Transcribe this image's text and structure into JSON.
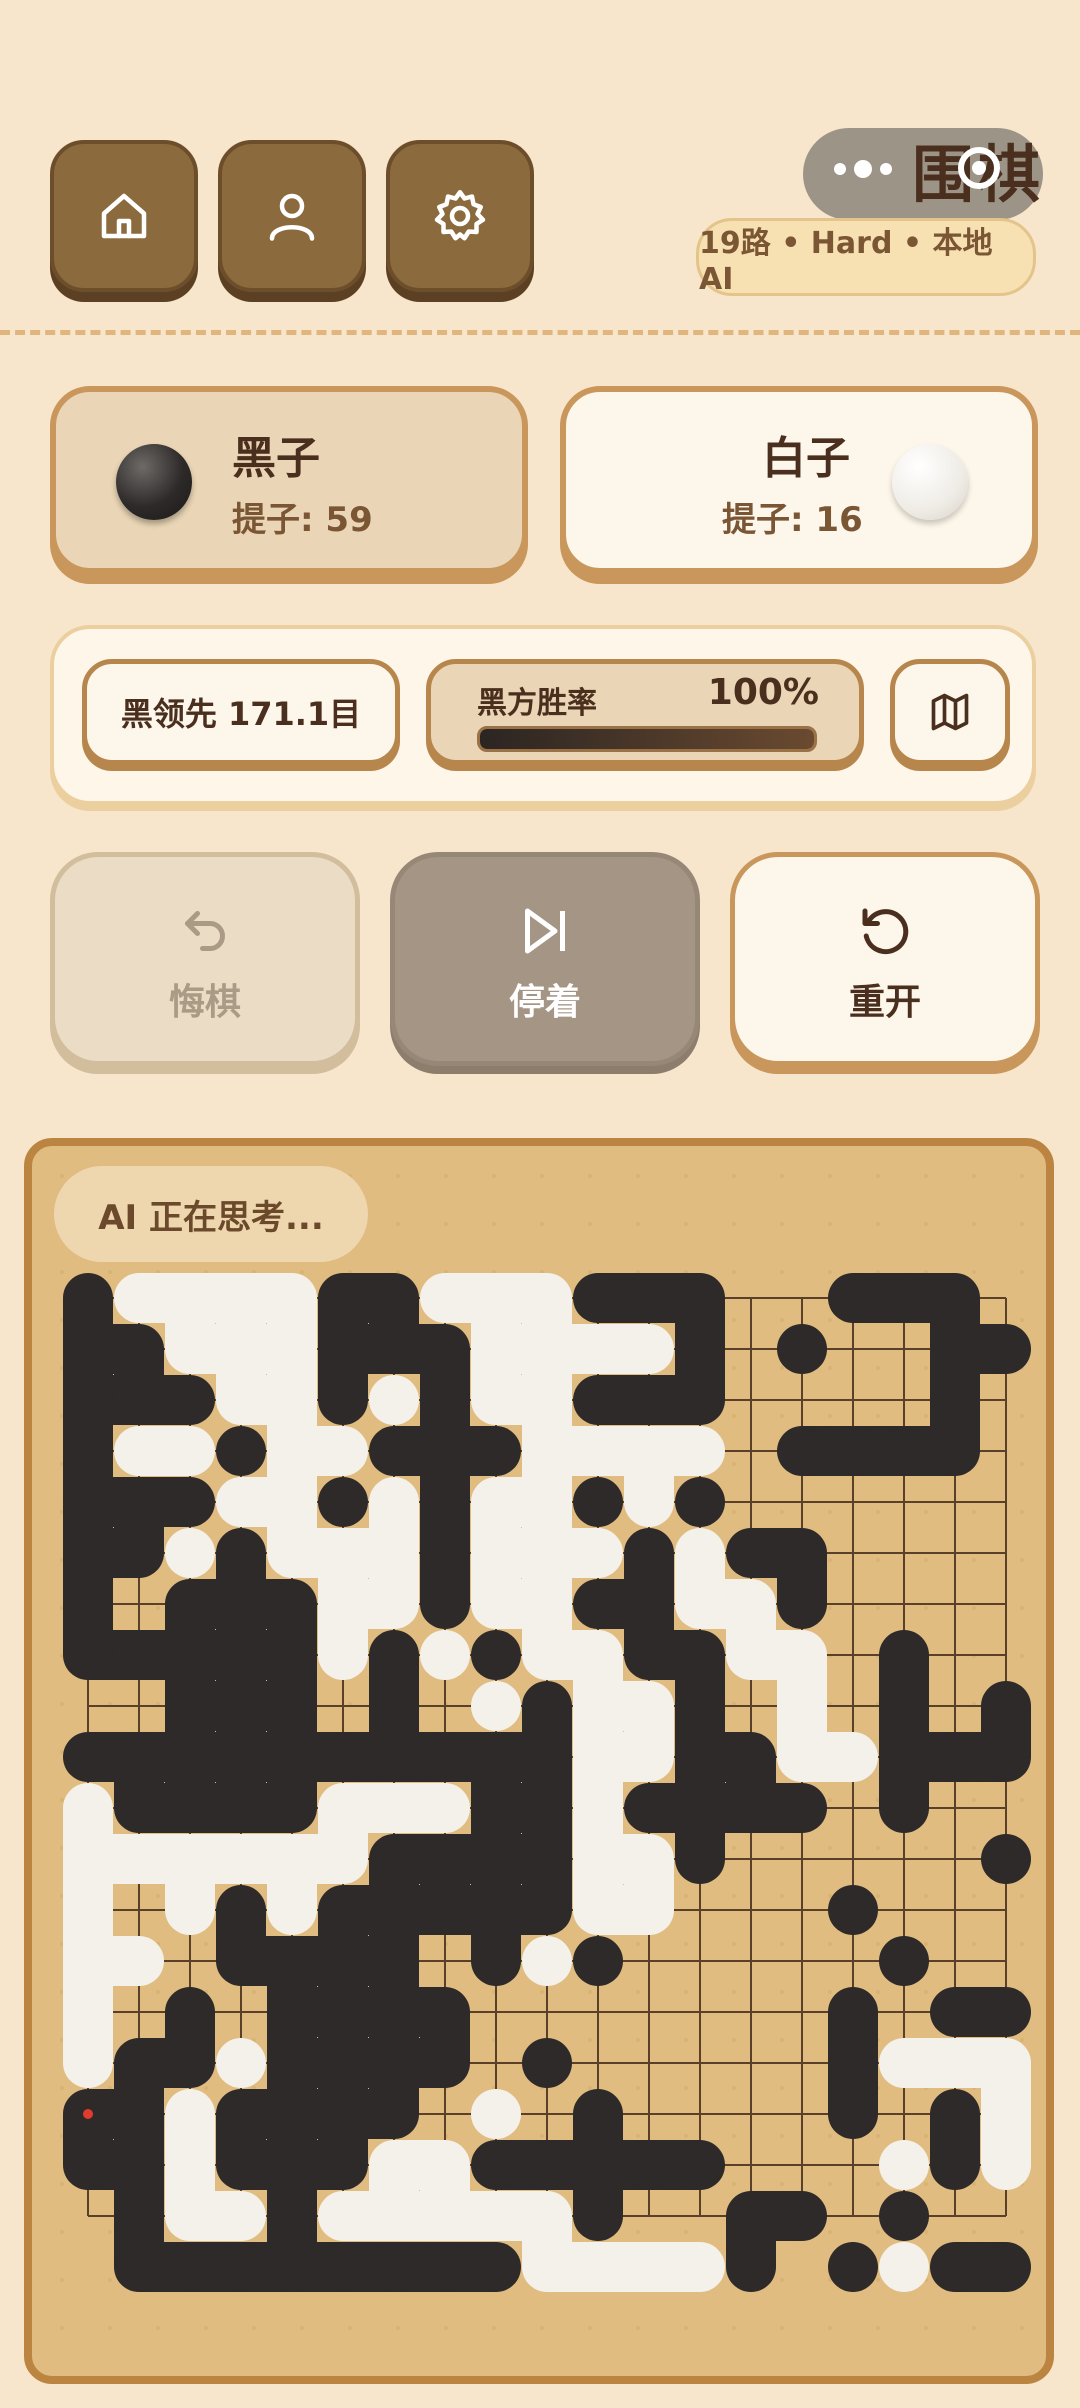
{
  "app": {
    "title": "围棋"
  },
  "header": {
    "nav": [
      {
        "name": "home-button",
        "icon": "home-icon"
      },
      {
        "name": "profile-button",
        "icon": "user-icon"
      },
      {
        "name": "settings-button",
        "icon": "gear-icon"
      }
    ],
    "game_info": "19路 • Hard • 本地 AI"
  },
  "players": {
    "black": {
      "name": "黑子",
      "captures": "提子: 59"
    },
    "white": {
      "name": "白子",
      "captures": "提子: 16"
    }
  },
  "status": {
    "lead": "黑领先 171.1目",
    "winrate_label": "黑方胜率",
    "winrate_value": "100%",
    "winrate": 1.0,
    "map_icon": "map-icon"
  },
  "actions": {
    "undo": "悔棋",
    "pass": "停着",
    "restart": "重开"
  },
  "board": {
    "thinking": "AI 正在思考...",
    "size": 19,
    "rows": [
      "BWWWWBBWWWBBB..BBB.",
      "BBWWWBBBWWWWB.B..BB",
      "BBBWWBWBWWBBB....B.",
      "BWWBWWBBBWWWW.BBBB.",
      "BBBWWBWBWWBWB......",
      "BBWBWWWBWWWBWBB....",
      "B.BBBWWBWWBBWWB....",
      "BBBBBWBWBWWBBWW.B..",
      "..BBB.B.WBWWB.W.B.B",
      "BBBBBBBBBBWWBBWWBBB",
      "WBBBBWWWBBWBBBB.B..",
      "WWWWWWBBBBWWB.....B",
      "W.WBWBBBBBWW...B...",
      "WW.BBBB.BWB.....B..",
      "W.B.BBBB.......B.BB",
      "WBBWBBBB.B.....BWWW",
      "BBWBBBB.W.B....B.BW",
      "BBWBBBWWBBBBB...WBW",
      ".BWWBWWWWWB..BB.B..",
      ".BBBBBBBBWWWWB.BWBB"
    ]
  },
  "colors": {
    "black_stone": "#2d2a29",
    "white_stone": "#f4f1ea",
    "board": "#e1bc80",
    "accent": "#8b6a3d"
  }
}
